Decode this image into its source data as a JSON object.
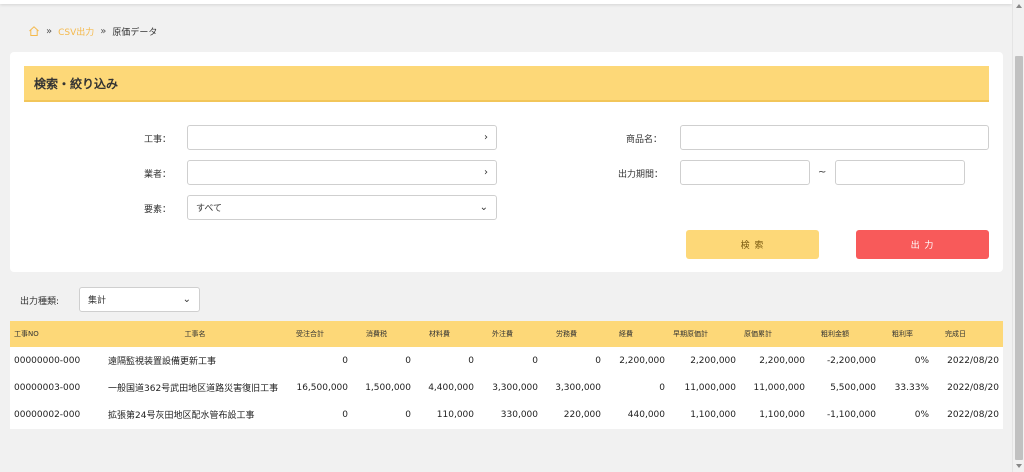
{
  "breadcrumb": {
    "link": "CSV出力",
    "current": "原価データ",
    "separator": "»"
  },
  "search_panel": {
    "title": "検索・絞り込み",
    "labels": {
      "project": "工事：",
      "vendor": "業者：",
      "element": "要素：",
      "product": "商品名：",
      "period": "出力期間："
    },
    "element_value": "すべて",
    "period_separator": "~",
    "search_button": "検 索",
    "output_button": "出 力"
  },
  "output_type": {
    "label": "出力種類:",
    "value": "集計"
  },
  "table": {
    "headers": [
      "工事NO",
      "工事名",
      "受注合計",
      "消費税",
      "材料費",
      "外注費",
      "労務費",
      "経費",
      "早期原価計",
      "原価累計",
      "粗利金額",
      "粗利率",
      "完成日"
    ],
    "rows": [
      [
        "00000000-000",
        "遠隔監視装置設備更新工事",
        "0",
        "0",
        "0",
        "0",
        "0",
        "2,200,000",
        "2,200,000",
        "2,200,000",
        "-2,200,000",
        "0%",
        "2022/08/20"
      ],
      [
        "00000003-000",
        "一般国道362号武田地区道路災害復旧工事",
        "16,500,000",
        "1,500,000",
        "4,400,000",
        "3,300,000",
        "3,300,000",
        "0",
        "11,000,000",
        "11,000,000",
        "5,500,000",
        "33.33%",
        "2022/08/20"
      ],
      [
        "00000002-000",
        "拡張第24号灰田地区配水管布設工事",
        "0",
        "0",
        "110,000",
        "330,000",
        "220,000",
        "440,000",
        "1,100,000",
        "1,100,000",
        "-1,100,000",
        "0%",
        "2022/08/20"
      ]
    ]
  },
  "colors": {
    "accent": "#fdd878",
    "danger": "#f85a5a",
    "link": "#f5b94b"
  }
}
